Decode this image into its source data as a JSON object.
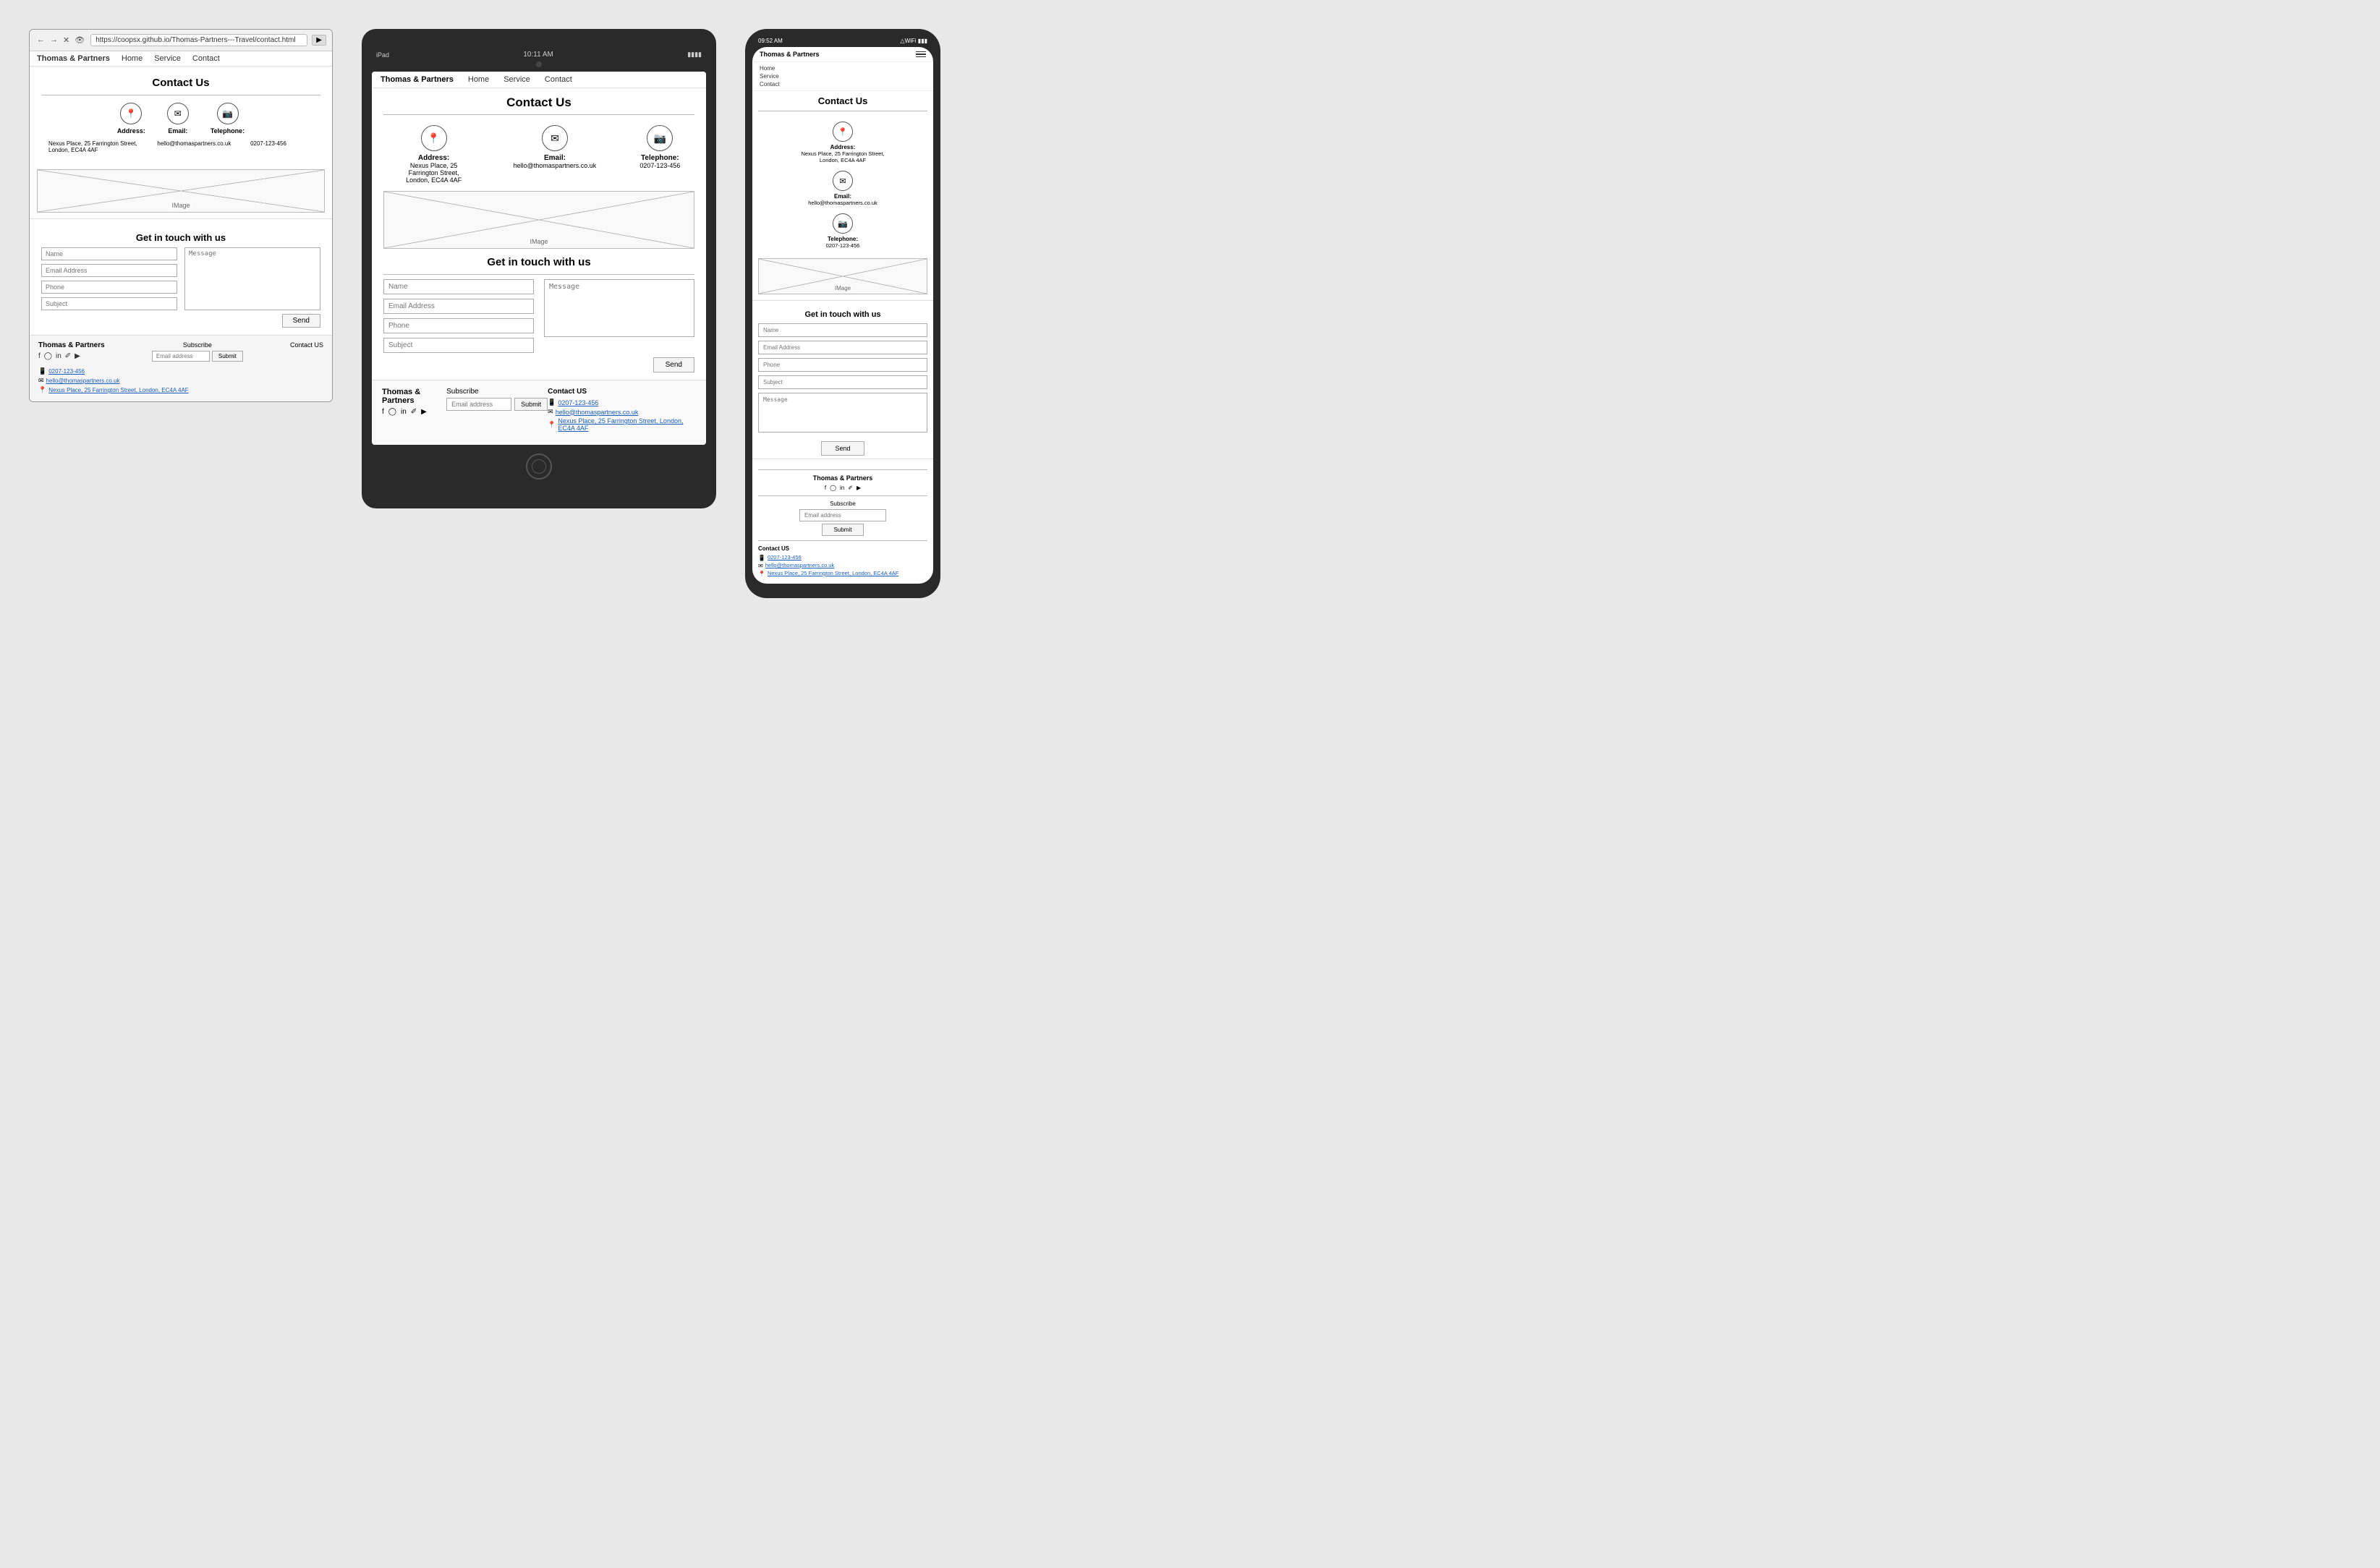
{
  "brand": "Thomas & Partners",
  "nav": {
    "items": [
      "Home",
      "Service",
      "Contact"
    ]
  },
  "url": "https://coopsx.github.io/Thomas-Partners---Travel/contact.html",
  "page": {
    "title": "Contact Us",
    "image_label": "IMage",
    "subtitle": "Get in touch with us"
  },
  "contact": {
    "address_label": "Address:",
    "address_value": "Nexus Place, 25 Farrington Street, London, EC4A 4AF",
    "address_value_tablet": "Nexus Place, 25 Farrington Street, London, EC4A 4AF",
    "email_label": "Email:",
    "email_value": "hello@thomaspartners.co.uk",
    "telephone_label": "Telephone:",
    "telephone_value": "0207-123-456",
    "icons": {
      "address": "📍",
      "email": "✉",
      "telephone": "📷"
    }
  },
  "form": {
    "name_placeholder": "Name",
    "email_placeholder": "Email Address",
    "phone_placeholder": "Phone",
    "subject_placeholder": "Subject",
    "message_placeholder": "Message",
    "send_label": "Send"
  },
  "footer": {
    "brand": "Thomas & Partners",
    "subscribe_label": "Subscribe",
    "email_placeholder": "Email address",
    "submit_label": "Submit",
    "contact_us_label": "Contact US",
    "social_icons": [
      "f",
      "◎",
      "in",
      "🐦",
      "▶"
    ],
    "phone_link": "0207-123-456",
    "email_link": "hello@thomaspartners.co.uk",
    "address_link": "Nexus Place, 25 Farrington Street, London, EC4A 4AF"
  },
  "tablet": {
    "status_left": "iPad",
    "time": "10:11 AM",
    "battery": "▓▓▓▓"
  },
  "mobile": {
    "time": "09:52 AM",
    "status": "▾WiFi ▓▓"
  }
}
